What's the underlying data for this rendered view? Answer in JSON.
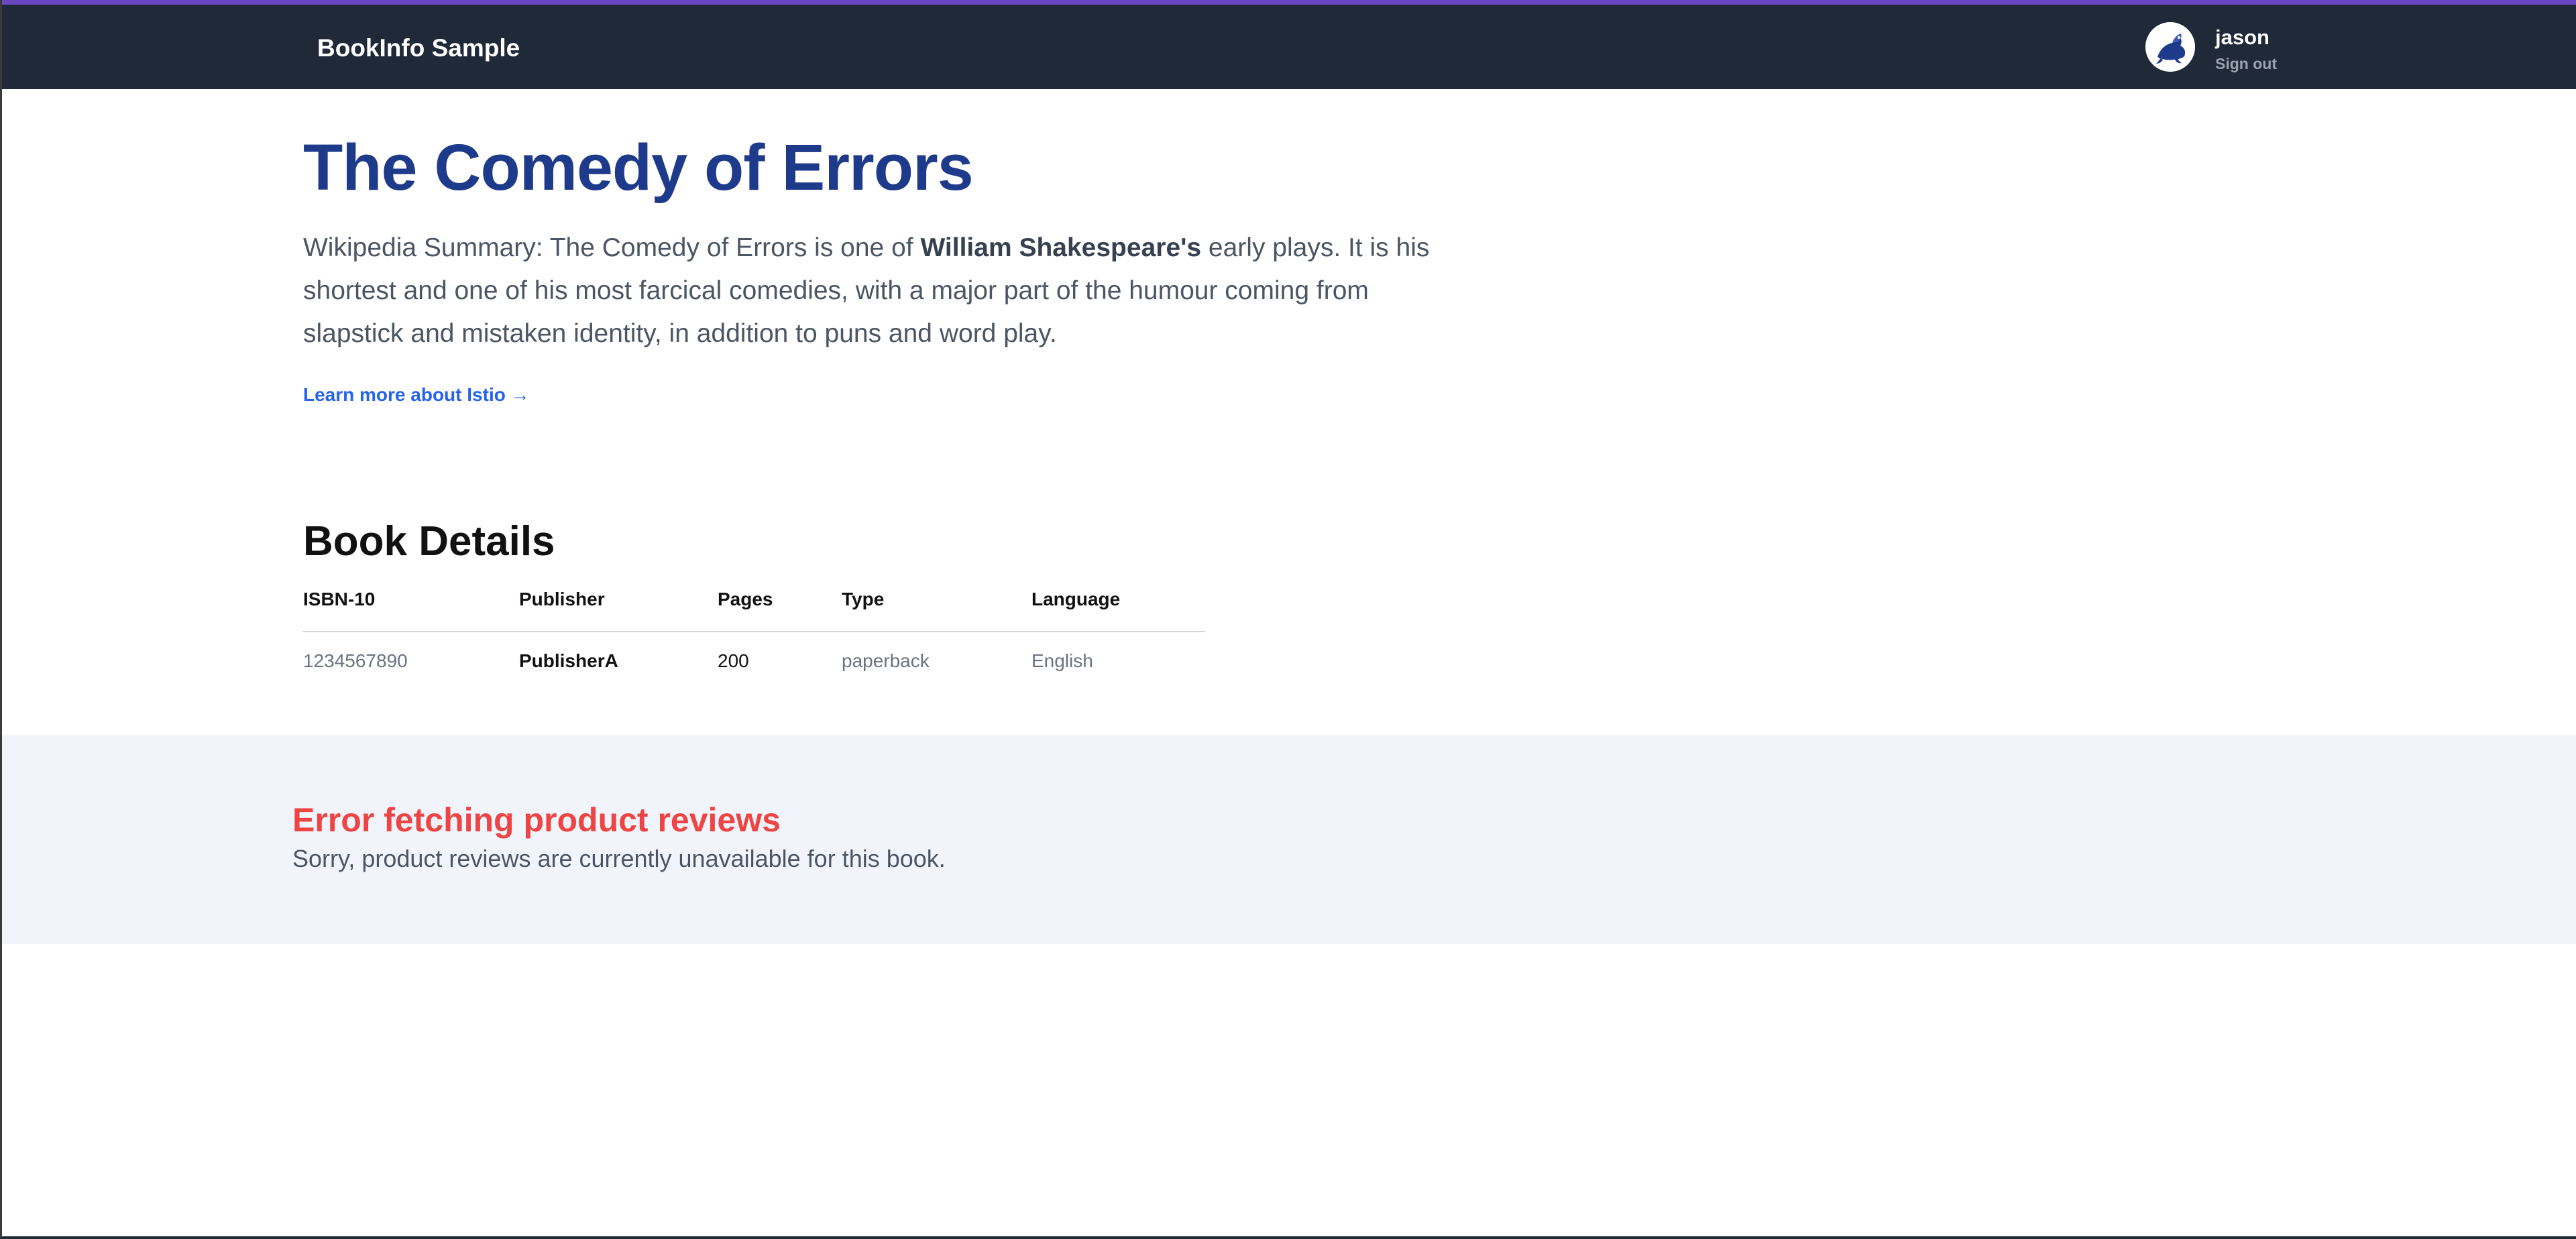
{
  "header": {
    "brand": "BookInfo Sample",
    "user_name": "jason",
    "sign_out_label": "Sign out",
    "avatar_icon": "seal-mascot-icon",
    "background_color": "#1f2937",
    "accent_color": "#6b46c1"
  },
  "product": {
    "title": "The Comedy of Errors",
    "summary_prefix": "Wikipedia Summary: The Comedy of Errors is one of ",
    "summary_bold": "William Shakespeare's",
    "summary_suffix": " early plays. It is his shortest and one of his most farcical comedies, with a major part of the humour coming from slapstick and mistaken identity, in addition to puns and word play.",
    "learn_more_label": "Learn more about Istio →",
    "title_color": "#1e3a8a",
    "link_color": "#2563eb"
  },
  "details": {
    "title": "Book Details",
    "columns": [
      "ISBN-10",
      "Publisher",
      "Pages",
      "Type",
      "Language"
    ],
    "rows": [
      [
        "1234567890",
        "PublisherA",
        "200",
        "paperback",
        "English"
      ]
    ]
  },
  "reviews": {
    "error_title": "Error fetching product reviews",
    "error_message": "Sorry, product reviews are currently unavailable for this book.",
    "error_color": "#ef4444",
    "panel_color": "#f1f5fb"
  }
}
